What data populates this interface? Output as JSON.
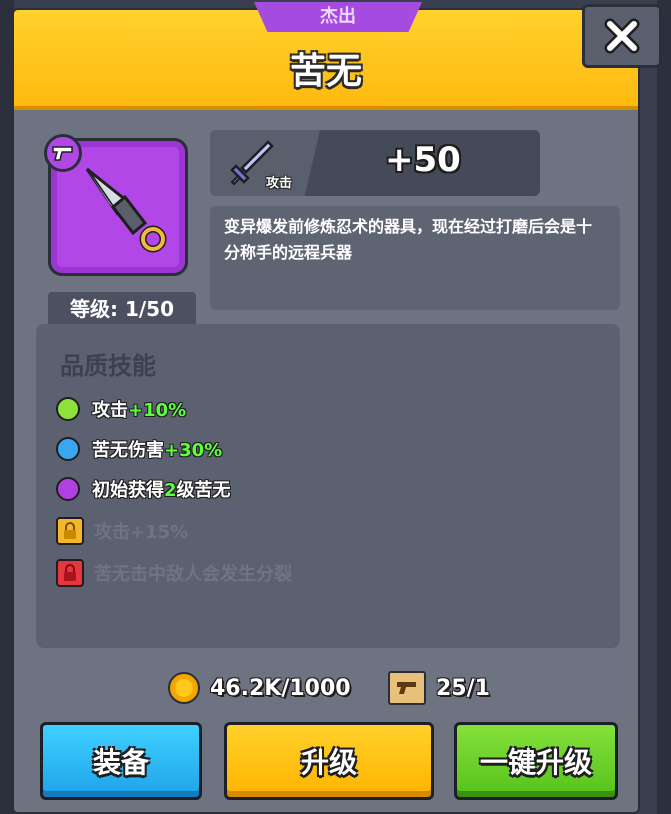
{
  "rarity": "杰出",
  "item": {
    "name": "苦无",
    "icon": "kunai-icon",
    "badge_icon": "gun-icon",
    "level_text": "等级: 1/50"
  },
  "stat": {
    "icon": "sword-icon",
    "label": "攻击",
    "value": "+50"
  },
  "description": "变异爆发前修炼忍术的器具，现在经过打磨后会是十分称手的远程兵器",
  "skills": {
    "title": "品质技能",
    "items": [
      {
        "prefix": "攻击",
        "highlight": "+10%",
        "suffix": "",
        "dot_color": "#8ee03a",
        "locked": false
      },
      {
        "prefix": "苦无伤害",
        "highlight": "+30%",
        "suffix": "",
        "dot_color": "#3aa6f0",
        "locked": false
      },
      {
        "prefix": "初始获得",
        "highlight": "2",
        "suffix": "级苦无",
        "dot_color": "#b23fe0",
        "locked": false
      },
      {
        "text": "攻击+15%",
        "lock_color": "#f4b62a",
        "locked": true
      },
      {
        "text": "苦无击中敌人会发生分裂",
        "lock_color": "#e8363f",
        "locked": true
      }
    ]
  },
  "currency": {
    "coins": {
      "icon": "coin-icon",
      "text": "46.2K/1000"
    },
    "blueprints": {
      "icon": "blueprint-scroll-icon",
      "text": "25/1"
    }
  },
  "buttons": {
    "equip": "装备",
    "upgrade": "升级",
    "one_click_upgrade": "一键升级"
  },
  "colors": {
    "header": "#ffc21a",
    "rarity_tab": "#a64be0",
    "equip_button": "#1ea3e8",
    "upgrade_button": "#ffb300",
    "one_click_button": "#55c21b"
  }
}
